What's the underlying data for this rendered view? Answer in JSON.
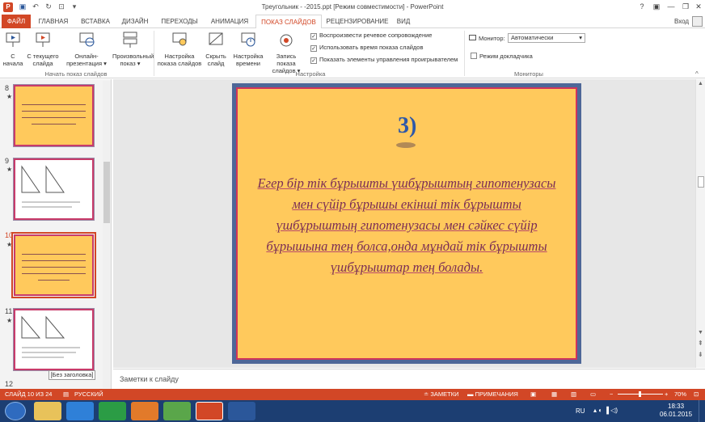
{
  "window": {
    "title": "Треугольник  - -2015.ppt [Режим совместимости] - PowerPoint",
    "help": "?",
    "signin": "Вход"
  },
  "tabs": [
    {
      "label": "ФАЙЛ"
    },
    {
      "label": "ГЛАВНАЯ"
    },
    {
      "label": "ВСТАВКА"
    },
    {
      "label": "ДИЗАЙН"
    },
    {
      "label": "ПЕРЕХОДЫ"
    },
    {
      "label": "АНИМАЦИЯ"
    },
    {
      "label": "ПОКАЗ СЛАЙДОВ"
    },
    {
      "label": "РЕЦЕНЗИРОВАНИЕ"
    },
    {
      "label": "ВИД"
    }
  ],
  "ribbon": {
    "start": {
      "btn1_l1": "С",
      "btn1_l2": "начала",
      "btn2_l1": "С текущего",
      "btn2_l2": "слайда",
      "btn3_l1": "Онлайн-",
      "btn3_l2": "презентация ▾",
      "btn4_l1": "Произвольный",
      "btn4_l2": "показ ▾",
      "group": "Начать показ слайдов"
    },
    "setup": {
      "btn1_l1": "Настройка",
      "btn1_l2": "показа слайдов",
      "btn2_l1": "Скрыть",
      "btn2_l2": "слайд",
      "btn3_l1": "Настройка",
      "btn3_l2": "времени",
      "btn4_l1": "Запись показа",
      "btn4_l2": "слайдов ▾",
      "group": "Настройка"
    },
    "checks": {
      "c1": "Воспроизвести речевое сопровождение",
      "c2": "Использовать время показа слайдов",
      "c3": "Показать элементы управления проигрывателем"
    },
    "monitors": {
      "monitor_label": "Монитор:",
      "monitor_value": "Автоматически",
      "presenter": "Режим докладчика",
      "group": "Мониторы"
    }
  },
  "thumbnails": [
    {
      "num": "8",
      "star": "★"
    },
    {
      "num": "9",
      "star": "★"
    },
    {
      "num": "10",
      "star": "★"
    },
    {
      "num": "11",
      "star": "★"
    },
    {
      "num": "12",
      "star": ""
    }
  ],
  "tooltip": "[Без заголовка]",
  "slide": {
    "number_label": "3)",
    "body": "Егер бір тік бұрышты үшбұрыштың гипотенузасы мен сүйір бұрышы екінші тік бұрышты үшбұрыштың гипотенузасы мен сәйкес сүйір бұрышына тең болса,онда мұндай тік бұрышты үшбұрыштар тең болады."
  },
  "notes": {
    "placeholder": "Заметки к слайду"
  },
  "statusbar": {
    "slide_info": "СЛАЙД 10 ИЗ 24",
    "language": "РУССКИЙ",
    "notes": "ЗАМЕТКИ",
    "comments": "ПРИМЕЧАНИЯ",
    "zoom": "70%"
  },
  "taskbar": {
    "lang": "RU",
    "time": "18:33",
    "date": "06.01.2015"
  },
  "colors": {
    "accent": "#d24726",
    "slide_bg": "#ffc95c",
    "slide_frame": "#4e6798",
    "text": "#7a2d55"
  }
}
